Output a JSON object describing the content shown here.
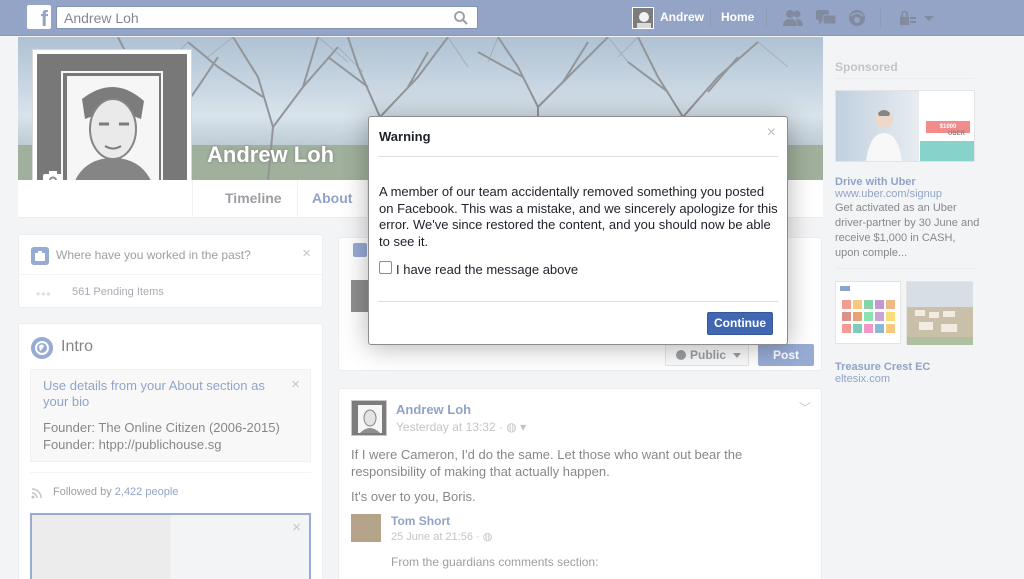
{
  "topbar": {
    "logo_letter": "f",
    "search_value": "Andrew Loh",
    "user_name": "Andrew",
    "home_label": "Home",
    "icons": [
      "search-icon",
      "friends-icon",
      "messages-icon",
      "notifications-icon",
      "privacy-icon",
      "chevron-down-icon"
    ]
  },
  "profile": {
    "name": "Andrew Loh",
    "tabs": [
      {
        "label": "Timeline"
      },
      {
        "label": "About"
      }
    ]
  },
  "work_prompt": {
    "text": "Where have you worked in the past?",
    "close": "×",
    "dots": "•••",
    "pending": "561 Pending Items"
  },
  "intro": {
    "title": "Intro",
    "bio_link": "Use details from your About section as your bio",
    "close": "×",
    "lines": [
      "Founder: The Online Citizen (2006-2015)",
      "Founder: htpp://publichouse.sg"
    ],
    "followed_prefix": "Followed by ",
    "followed_count": "2,422 people",
    "photo_close": "×"
  },
  "composer": {
    "public_label": "Public",
    "post_label": "Post"
  },
  "post": {
    "author": "Andrew Loh",
    "time": "Yesterday at 13:32 · ",
    "paragraph1": "If I were Cameron, I'd do the same. Let those who want out bear the responsibility of making that actually happen.",
    "paragraph2": "It's over to you, Boris.",
    "shared_author": "Tom Short",
    "shared_time": "25 June at 21:56 · ",
    "shared_body": "From the guardians comments section:"
  },
  "sidebar": {
    "sponsored": "Sponsored",
    "ad1": {
      "title": "Drive with Uber",
      "url": "www.uber.com/signup",
      "desc": "Get activated as an Uber driver-partner by 30 June and receive $1,000 in CASH, upon comple...",
      "tag": "$1000",
      "logo": "UBER"
    },
    "ad2": {
      "title": "Treasure Crest EC",
      "url": "eltesix.com"
    }
  },
  "modal": {
    "title": "Warning",
    "close": "×",
    "body": "A member of our team accidentally removed something you posted on Facebook. This was a mistake, and we sincerely apologize for this error. We've since restored the content, and you should now be able to see it.",
    "checkbox_label": "I have read the message above",
    "checkbox_checked": false,
    "continue_label": "Continue"
  },
  "colors": {
    "brand": "#3b5998",
    "button": "#4267b2",
    "link": "#365899"
  }
}
